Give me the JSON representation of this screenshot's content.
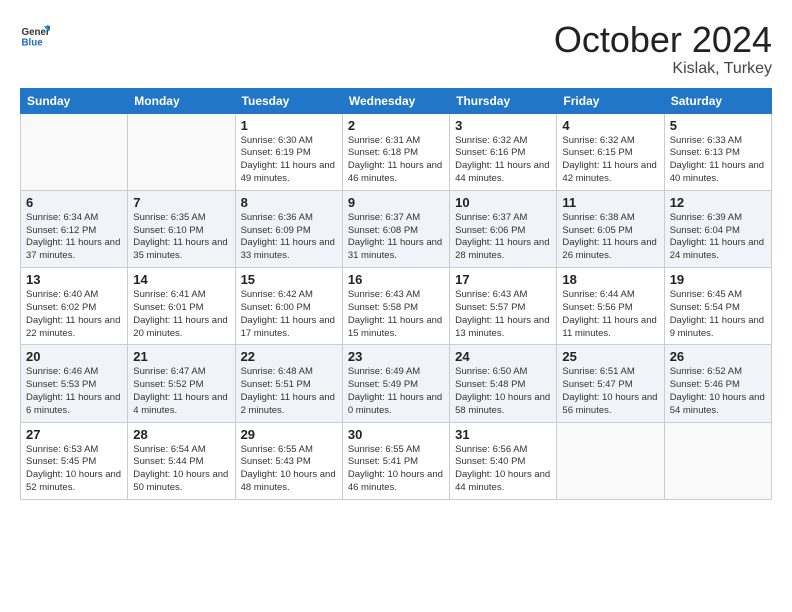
{
  "logo": {
    "general": "General",
    "blue": "Blue"
  },
  "header": {
    "month": "October 2024",
    "location": "Kislak, Turkey"
  },
  "columns": [
    "Sunday",
    "Monday",
    "Tuesday",
    "Wednesday",
    "Thursday",
    "Friday",
    "Saturday"
  ],
  "weeks": [
    [
      {
        "day": "",
        "sunrise": "",
        "sunset": "",
        "daylight": ""
      },
      {
        "day": "",
        "sunrise": "",
        "sunset": "",
        "daylight": ""
      },
      {
        "day": "1",
        "sunrise": "Sunrise: 6:30 AM",
        "sunset": "Sunset: 6:19 PM",
        "daylight": "Daylight: 11 hours and 49 minutes."
      },
      {
        "day": "2",
        "sunrise": "Sunrise: 6:31 AM",
        "sunset": "Sunset: 6:18 PM",
        "daylight": "Daylight: 11 hours and 46 minutes."
      },
      {
        "day": "3",
        "sunrise": "Sunrise: 6:32 AM",
        "sunset": "Sunset: 6:16 PM",
        "daylight": "Daylight: 11 hours and 44 minutes."
      },
      {
        "day": "4",
        "sunrise": "Sunrise: 6:32 AM",
        "sunset": "Sunset: 6:15 PM",
        "daylight": "Daylight: 11 hours and 42 minutes."
      },
      {
        "day": "5",
        "sunrise": "Sunrise: 6:33 AM",
        "sunset": "Sunset: 6:13 PM",
        "daylight": "Daylight: 11 hours and 40 minutes."
      }
    ],
    [
      {
        "day": "6",
        "sunrise": "Sunrise: 6:34 AM",
        "sunset": "Sunset: 6:12 PM",
        "daylight": "Daylight: 11 hours and 37 minutes."
      },
      {
        "day": "7",
        "sunrise": "Sunrise: 6:35 AM",
        "sunset": "Sunset: 6:10 PM",
        "daylight": "Daylight: 11 hours and 35 minutes."
      },
      {
        "day": "8",
        "sunrise": "Sunrise: 6:36 AM",
        "sunset": "Sunset: 6:09 PM",
        "daylight": "Daylight: 11 hours and 33 minutes."
      },
      {
        "day": "9",
        "sunrise": "Sunrise: 6:37 AM",
        "sunset": "Sunset: 6:08 PM",
        "daylight": "Daylight: 11 hours and 31 minutes."
      },
      {
        "day": "10",
        "sunrise": "Sunrise: 6:37 AM",
        "sunset": "Sunset: 6:06 PM",
        "daylight": "Daylight: 11 hours and 28 minutes."
      },
      {
        "day": "11",
        "sunrise": "Sunrise: 6:38 AM",
        "sunset": "Sunset: 6:05 PM",
        "daylight": "Daylight: 11 hours and 26 minutes."
      },
      {
        "day": "12",
        "sunrise": "Sunrise: 6:39 AM",
        "sunset": "Sunset: 6:04 PM",
        "daylight": "Daylight: 11 hours and 24 minutes."
      }
    ],
    [
      {
        "day": "13",
        "sunrise": "Sunrise: 6:40 AM",
        "sunset": "Sunset: 6:02 PM",
        "daylight": "Daylight: 11 hours and 22 minutes."
      },
      {
        "day": "14",
        "sunrise": "Sunrise: 6:41 AM",
        "sunset": "Sunset: 6:01 PM",
        "daylight": "Daylight: 11 hours and 20 minutes."
      },
      {
        "day": "15",
        "sunrise": "Sunrise: 6:42 AM",
        "sunset": "Sunset: 6:00 PM",
        "daylight": "Daylight: 11 hours and 17 minutes."
      },
      {
        "day": "16",
        "sunrise": "Sunrise: 6:43 AM",
        "sunset": "Sunset: 5:58 PM",
        "daylight": "Daylight: 11 hours and 15 minutes."
      },
      {
        "day": "17",
        "sunrise": "Sunrise: 6:43 AM",
        "sunset": "Sunset: 5:57 PM",
        "daylight": "Daylight: 11 hours and 13 minutes."
      },
      {
        "day": "18",
        "sunrise": "Sunrise: 6:44 AM",
        "sunset": "Sunset: 5:56 PM",
        "daylight": "Daylight: 11 hours and 11 minutes."
      },
      {
        "day": "19",
        "sunrise": "Sunrise: 6:45 AM",
        "sunset": "Sunset: 5:54 PM",
        "daylight": "Daylight: 11 hours and 9 minutes."
      }
    ],
    [
      {
        "day": "20",
        "sunrise": "Sunrise: 6:46 AM",
        "sunset": "Sunset: 5:53 PM",
        "daylight": "Daylight: 11 hours and 6 minutes."
      },
      {
        "day": "21",
        "sunrise": "Sunrise: 6:47 AM",
        "sunset": "Sunset: 5:52 PM",
        "daylight": "Daylight: 11 hours and 4 minutes."
      },
      {
        "day": "22",
        "sunrise": "Sunrise: 6:48 AM",
        "sunset": "Sunset: 5:51 PM",
        "daylight": "Daylight: 11 hours and 2 minutes."
      },
      {
        "day": "23",
        "sunrise": "Sunrise: 6:49 AM",
        "sunset": "Sunset: 5:49 PM",
        "daylight": "Daylight: 11 hours and 0 minutes."
      },
      {
        "day": "24",
        "sunrise": "Sunrise: 6:50 AM",
        "sunset": "Sunset: 5:48 PM",
        "daylight": "Daylight: 10 hours and 58 minutes."
      },
      {
        "day": "25",
        "sunrise": "Sunrise: 6:51 AM",
        "sunset": "Sunset: 5:47 PM",
        "daylight": "Daylight: 10 hours and 56 minutes."
      },
      {
        "day": "26",
        "sunrise": "Sunrise: 6:52 AM",
        "sunset": "Sunset: 5:46 PM",
        "daylight": "Daylight: 10 hours and 54 minutes."
      }
    ],
    [
      {
        "day": "27",
        "sunrise": "Sunrise: 6:53 AM",
        "sunset": "Sunset: 5:45 PM",
        "daylight": "Daylight: 10 hours and 52 minutes."
      },
      {
        "day": "28",
        "sunrise": "Sunrise: 6:54 AM",
        "sunset": "Sunset: 5:44 PM",
        "daylight": "Daylight: 10 hours and 50 minutes."
      },
      {
        "day": "29",
        "sunrise": "Sunrise: 6:55 AM",
        "sunset": "Sunset: 5:43 PM",
        "daylight": "Daylight: 10 hours and 48 minutes."
      },
      {
        "day": "30",
        "sunrise": "Sunrise: 6:55 AM",
        "sunset": "Sunset: 5:41 PM",
        "daylight": "Daylight: 10 hours and 46 minutes."
      },
      {
        "day": "31",
        "sunrise": "Sunrise: 6:56 AM",
        "sunset": "Sunset: 5:40 PM",
        "daylight": "Daylight: 10 hours and 44 minutes."
      },
      {
        "day": "",
        "sunrise": "",
        "sunset": "",
        "daylight": ""
      },
      {
        "day": "",
        "sunrise": "",
        "sunset": "",
        "daylight": ""
      }
    ]
  ]
}
